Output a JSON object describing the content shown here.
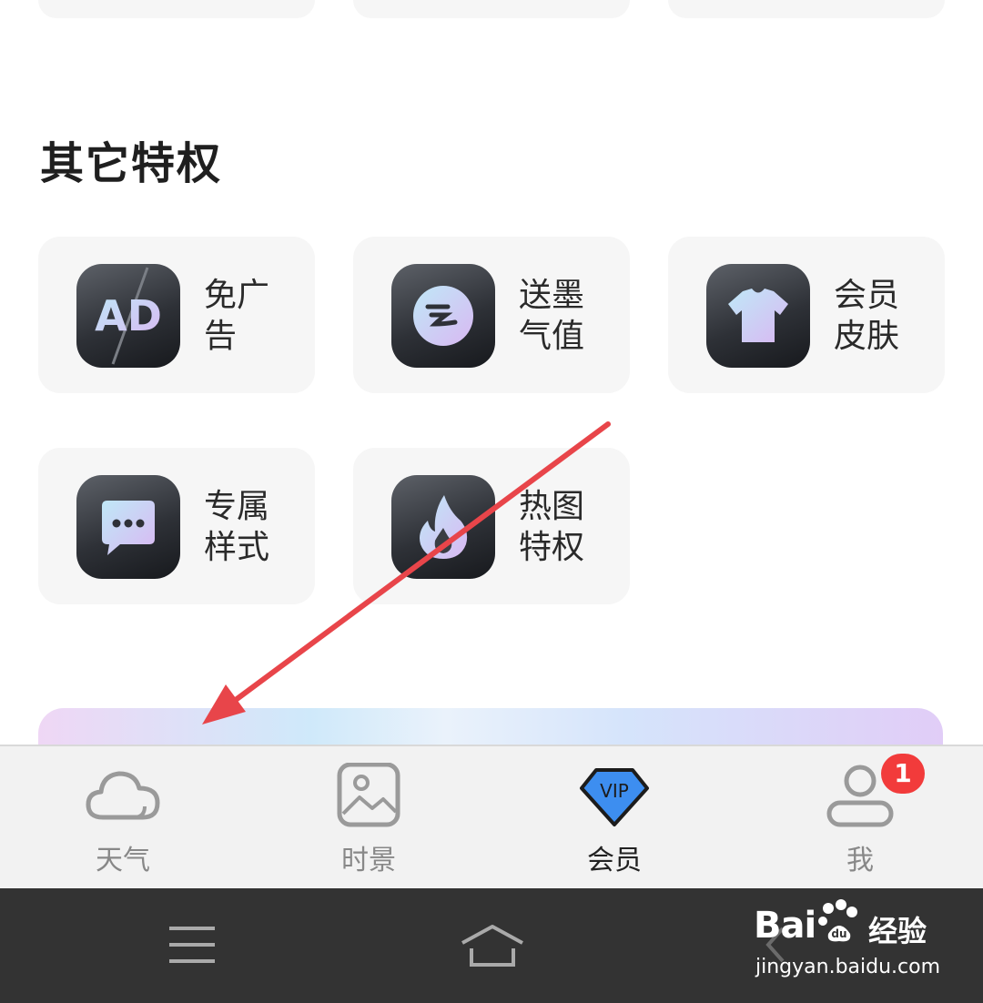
{
  "section": {
    "title": "其它特权"
  },
  "privileges": [
    {
      "label": "免广告",
      "icon": "ad-free-icon",
      "icon_text": "AD"
    },
    {
      "label": "送墨气值",
      "icon": "ink-value-icon"
    },
    {
      "label": "会员皮肤",
      "icon": "tshirt-icon"
    },
    {
      "label": "专属样式",
      "icon": "chat-bubble-icon"
    },
    {
      "label": "热图特权",
      "icon": "flame-icon"
    }
  ],
  "tabbar": {
    "tabs": [
      {
        "label": "天气",
        "icon": "cloud-icon",
        "active": false
      },
      {
        "label": "时景",
        "icon": "image-icon",
        "active": false
      },
      {
        "label": "会员",
        "icon": "vip-diamond-icon",
        "icon_text": "VIP",
        "active": true
      },
      {
        "label": "我",
        "icon": "user-icon",
        "active": false
      }
    ],
    "badge_count": "1"
  },
  "navbar": {
    "buttons": [
      "menu-icon",
      "home-icon",
      "back-icon"
    ]
  },
  "watermark": {
    "brand": "Bai",
    "brand_cn": "经验",
    "brand_du": "du",
    "url": "jingyan.baidu.com"
  },
  "colors": {
    "accent_red": "#f23b3b",
    "arrow": "#e8454a",
    "vip_blue": "#3d8ef0",
    "icon_grad_start": "#bfe8f7",
    "icon_grad_end": "#d9b8f2"
  }
}
